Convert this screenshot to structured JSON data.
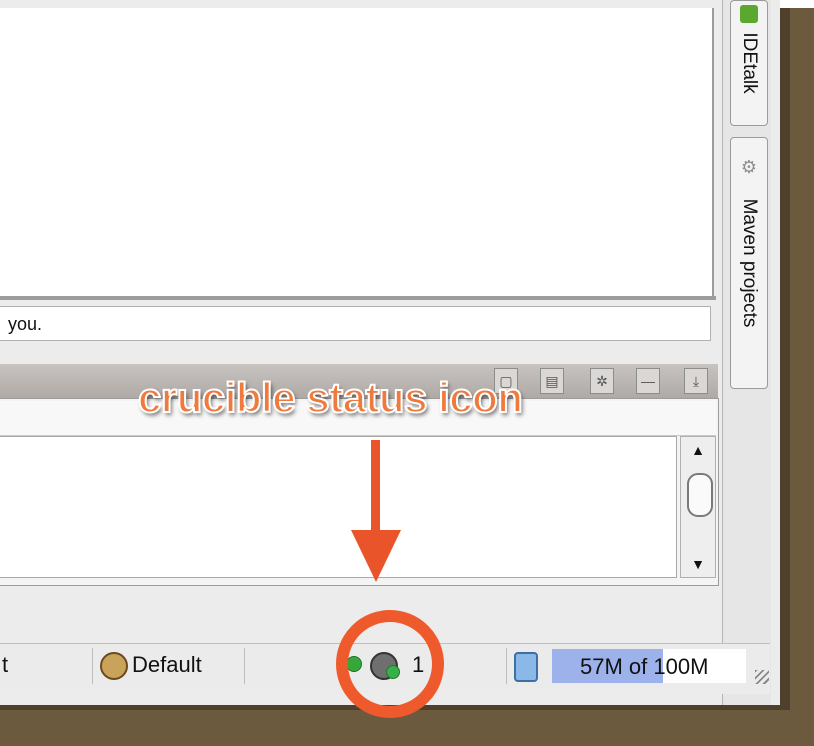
{
  "editor": {
    "status_line_text": "you."
  },
  "right_toolbar": {
    "tabs": [
      {
        "label": "IDEtalk",
        "icon": "idetalk-icon"
      },
      {
        "label": "Maven projects",
        "icon": "gear-icon"
      }
    ]
  },
  "tool_window": {
    "header_buttons": [
      "pin-icon",
      "layout-icon",
      "settings-icon",
      "minimize-icon",
      "hide-icon"
    ],
    "scrollbar": {
      "up": "▲",
      "down": "▼"
    }
  },
  "status_bar": {
    "left_text": "t",
    "profile_label": "Default",
    "crucible_count": "1",
    "memory_label": "57M of 100M",
    "memory_used_fraction": 0.57
  },
  "annotation": {
    "callout_text": "crucible status icon",
    "accent_color": "#ee5a2c"
  }
}
